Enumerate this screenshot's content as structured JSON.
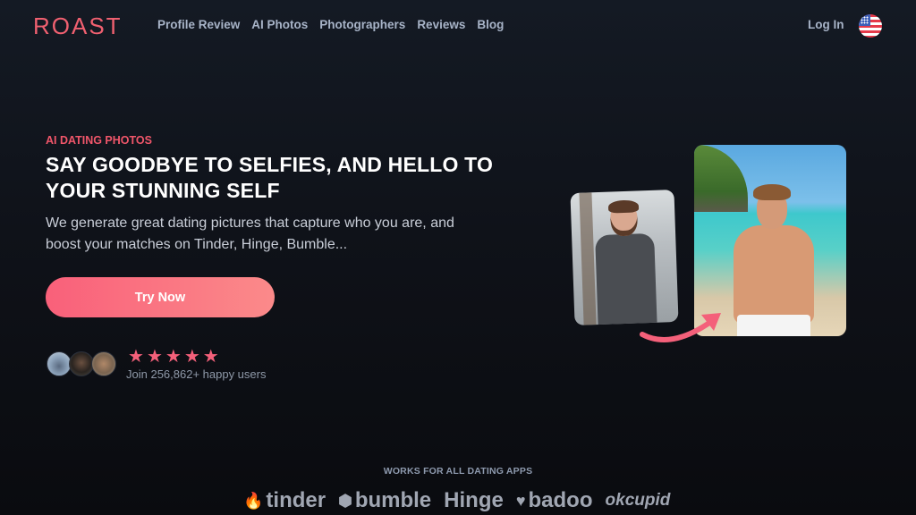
{
  "nav": {
    "logo": "ROAST",
    "links": [
      "Profile Review",
      "AI Photos",
      "Photographers",
      "Reviews",
      "Blog"
    ],
    "login": "Log In",
    "language_icon": "us-flag-icon"
  },
  "hero": {
    "eyebrow": "AI DATING PHOTOS",
    "headline": "SAY GOODBYE TO SELFIES, AND HELLO TO YOUR STUNNING SELF",
    "subtitle": "We generate great dating pictures that capture who you are, and boost your matches on Tinder, Hinge, Bumble...",
    "cta": "Try Now",
    "rating": 5,
    "stars": [
      "★",
      "★",
      "★",
      "★",
      "★"
    ],
    "social_proof": "Join 256,862+ happy users",
    "accent_color": "#f4607a"
  },
  "visual": {
    "before_photo": "Casual photo of man in grey shirt",
    "after_photo": "AI photo of man on beach",
    "arrow_icon": "curved-arrow-icon"
  },
  "apps": {
    "heading": "WORKS FOR ALL DATING APPS",
    "list": [
      {
        "name": "tinder",
        "icon": "🔥"
      },
      {
        "name": "bumble",
        "icon": "⬢"
      },
      {
        "name": "Hinge",
        "icon": ""
      },
      {
        "name": "badoo",
        "icon": "♥"
      },
      {
        "name": "okcupid",
        "icon": ""
      }
    ]
  }
}
